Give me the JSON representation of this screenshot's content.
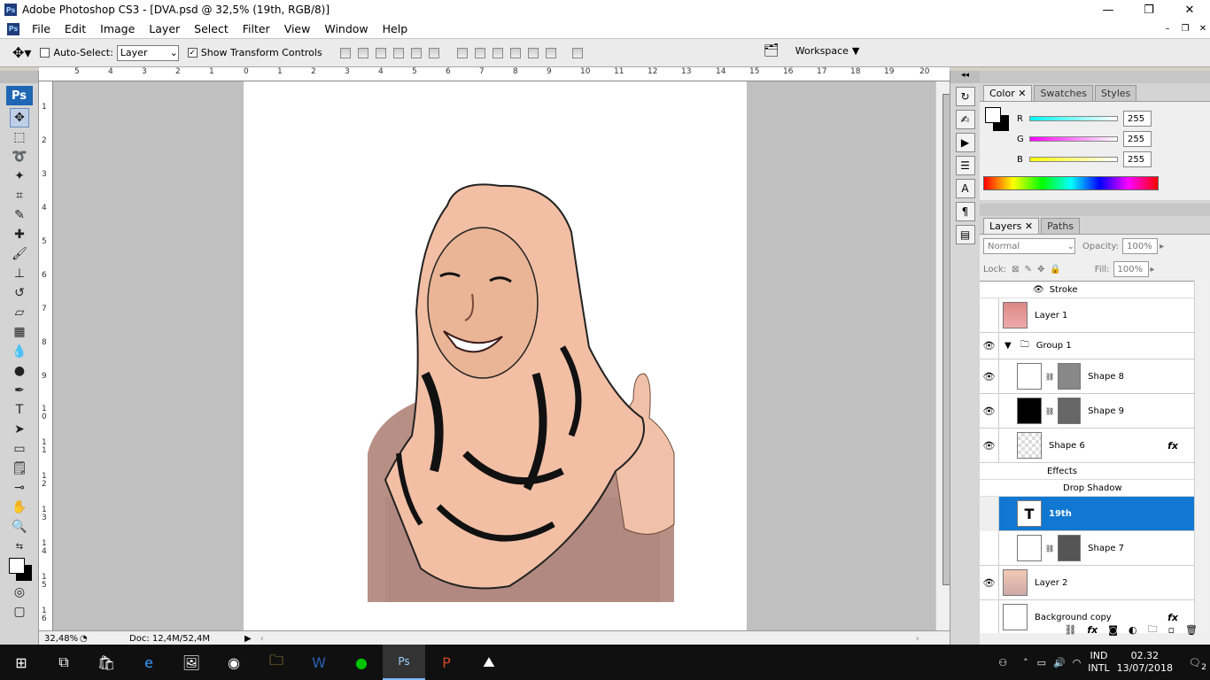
{
  "window": {
    "title": "Adobe Photoshop CS3 - [DVA.psd @ 32,5% (19th, RGB/8)]",
    "app_badge": "Ps"
  },
  "menu": [
    "File",
    "Edit",
    "Image",
    "Layer",
    "Select",
    "Filter",
    "View",
    "Window",
    "Help"
  ],
  "options": {
    "auto_select_label": "Auto-Select:",
    "auto_select_value": "Layer",
    "show_transform_label": "Show Transform Controls",
    "workspace_label": "Workspace"
  },
  "rulers": {
    "top": [
      "5",
      "4",
      "3",
      "2",
      "1",
      "0",
      "1",
      "2",
      "3",
      "4",
      "5",
      "6",
      "7",
      "8",
      "9",
      "10",
      "11",
      "12",
      "13",
      "14",
      "15",
      "16",
      "17",
      "18",
      "19",
      "20"
    ],
    "left": [
      "1",
      "2",
      "3",
      "4",
      "5",
      "6",
      "7",
      "8",
      "9",
      "1\n0",
      "1\n1",
      "1\n2",
      "1\n3",
      "1\n4",
      "1\n5",
      "1\n6"
    ]
  },
  "status": {
    "zoom": "32,48%",
    "doc": "Doc: 12,4M/52,4M"
  },
  "color_panel": {
    "tabs": [
      "Color",
      "Swatches",
      "Styles"
    ],
    "sliders": [
      {
        "label": "R",
        "value": "255"
      },
      {
        "label": "G",
        "value": "255"
      },
      {
        "label": "B",
        "value": "255"
      }
    ]
  },
  "layers_panel": {
    "tabs": [
      "Layers",
      "Paths"
    ],
    "blend_mode": "Normal",
    "opacity_label": "Opacity:",
    "opacity": "100%",
    "lock_label": "Lock:",
    "fill_label": "Fill:",
    "fill": "100%",
    "layers": [
      {
        "name": "Stroke",
        "type": "effect"
      },
      {
        "name": "Layer 1",
        "visible": false,
        "type": "layer"
      },
      {
        "name": "Group 1",
        "visible": true,
        "type": "group"
      },
      {
        "name": "Shape 8",
        "visible": true,
        "type": "shape"
      },
      {
        "name": "Shape 9",
        "visible": true,
        "type": "shape"
      },
      {
        "name": "Shape 6",
        "visible": true,
        "type": "shape",
        "fx": "fx"
      },
      {
        "name": "Effects",
        "type": "effect"
      },
      {
        "name": "Drop Shadow",
        "type": "effect"
      },
      {
        "name": "19th",
        "visible": false,
        "type": "text",
        "selected": true
      },
      {
        "name": "Shape 7",
        "visible": false,
        "type": "shape"
      },
      {
        "name": "Layer 2",
        "visible": true,
        "type": "layer"
      },
      {
        "name": "Background copy",
        "visible": false,
        "type": "layer",
        "fx": "fx"
      }
    ]
  },
  "taskbar": {
    "language": "IND",
    "language_sub": "INTL",
    "time": "02.32",
    "date": "13/07/2018",
    "notifications": "2"
  }
}
